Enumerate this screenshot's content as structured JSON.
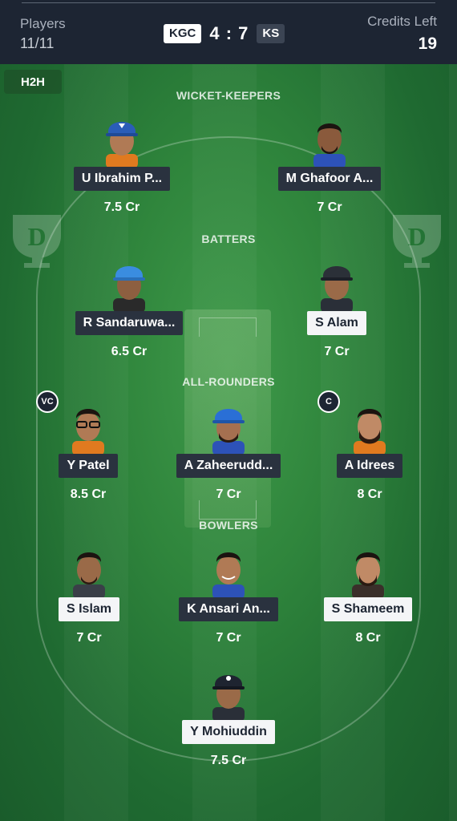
{
  "header": {
    "players_label": "Players",
    "players_count": "11/11",
    "team_a": "KGC",
    "score": "4 : 7",
    "team_b": "KS",
    "credits_label": "Credits Left",
    "credits_value": "19"
  },
  "field": {
    "mode_tab": "H2H",
    "sections": {
      "wk": "WICKET-KEEPERS",
      "bat": "BATTERS",
      "ar": "ALL-ROUNDERS",
      "bowl": "BOWLERS"
    }
  },
  "players": {
    "wk1": {
      "name": "U Ibrahim P...",
      "credits": "7.5 Cr",
      "team": "KGC"
    },
    "wk2": {
      "name": "M Ghafoor A...",
      "credits": "7 Cr",
      "team": "KS"
    },
    "bat1": {
      "name": "R Sandaruwa...",
      "credits": "6.5 Cr",
      "team": "KGC"
    },
    "bat2": {
      "name": "S Alam",
      "credits": "7 Cr",
      "team": "KS"
    },
    "ar1": {
      "name": "Y Patel",
      "credits": "8.5 Cr",
      "team": "KGC",
      "badge": "VC"
    },
    "ar2": {
      "name": "A Zaheerudd...",
      "credits": "7 Cr",
      "team": "KGC"
    },
    "ar3": {
      "name": "A Idrees",
      "credits": "8 Cr",
      "team": "KGC",
      "badge": "C"
    },
    "bowl1": {
      "name": "S Islam",
      "credits": "7 Cr",
      "team": "KS"
    },
    "bowl2": {
      "name": "K Ansari An...",
      "credits": "7 Cr",
      "team": "KGC"
    },
    "bowl3": {
      "name": "S Shameem",
      "credits": "8 Cr",
      "team": "KS"
    },
    "bowl4": {
      "name": "Y Mohiuddin",
      "credits": "7.5 Cr",
      "team": "KS"
    }
  },
  "colors": {
    "header_bg": "#1d2533",
    "field_green": "#2f853c",
    "dark_tag": "#2a323f",
    "light_tag": "#f4f5f7"
  }
}
